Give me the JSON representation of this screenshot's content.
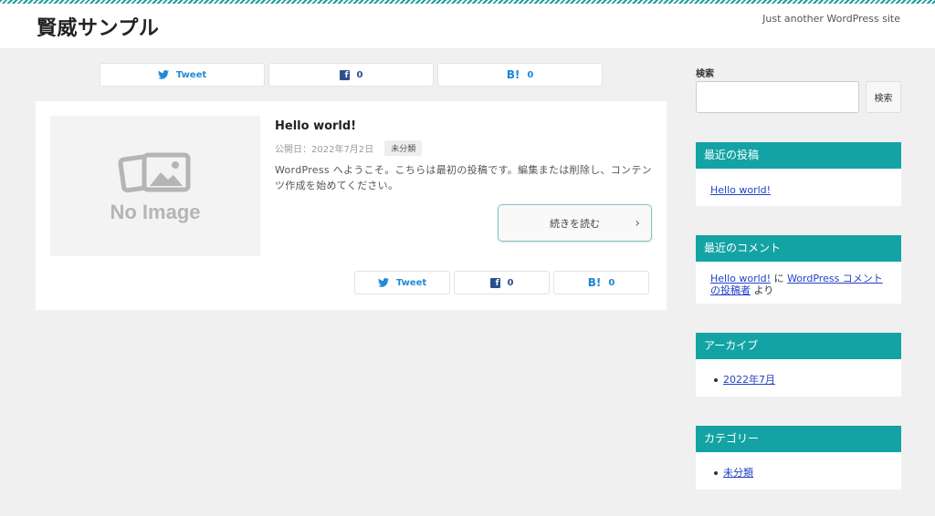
{
  "header": {
    "site_title": "賢威サンプル",
    "tagline": "Just another WordPress site"
  },
  "share_top": {
    "tweet_label": "Tweet",
    "facebook_count": "0",
    "hatena_count": "0"
  },
  "post": {
    "thumbnail_text": "No Image",
    "title": "Hello world!",
    "date": "公開日：2022年7月2日",
    "category": "未分類",
    "excerpt": "WordPress へようこそ。こちらは最初の投稿です。編集または削除し、コンテンツ作成を始めてください。",
    "readmore": "続きを読む"
  },
  "share_bottom": {
    "tweet_label": "Tweet",
    "facebook_count": "0",
    "hatena_count": "0"
  },
  "sidebar": {
    "search_label": "検索",
    "search_value": "",
    "search_button": "検索",
    "recent_posts": {
      "title": "最近の投稿",
      "items": [
        "Hello world!"
      ]
    },
    "recent_comments": {
      "title": "最近のコメント",
      "post_link": "Hello world!",
      "connector": " に ",
      "author_link": "WordPress コメントの投稿者",
      "suffix": " より"
    },
    "archives": {
      "title": "アーカイブ",
      "items": [
        "2022年7月"
      ]
    },
    "categories": {
      "title": "カテゴリー",
      "items": [
        "未分類"
      ]
    }
  },
  "colors": {
    "accent": "#14a3a4",
    "link": "#2242c8",
    "twitter": "#1f8bd3",
    "facebook": "#2b4f8f",
    "hatena": "#1c86d6"
  }
}
